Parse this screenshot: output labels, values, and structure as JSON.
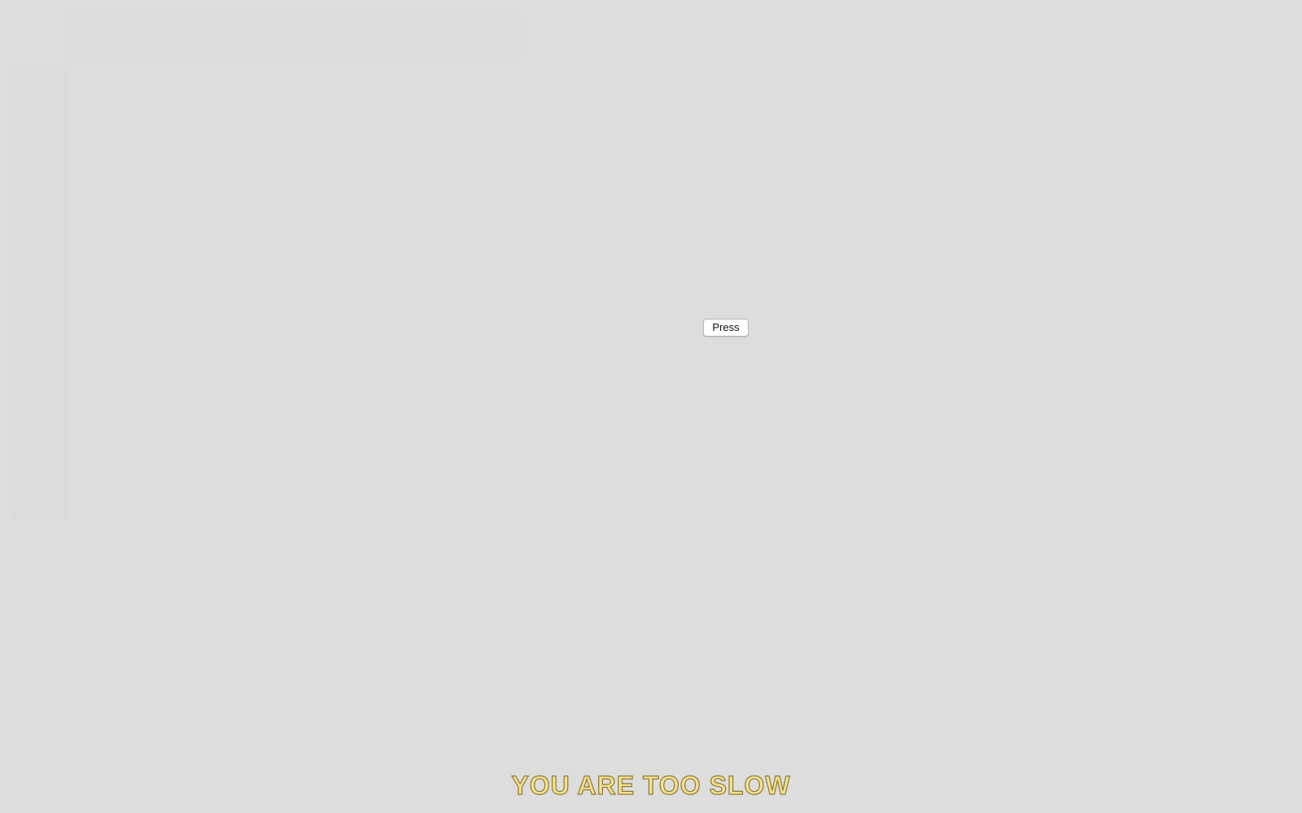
{
  "main": {
    "button_label": "Press",
    "message": "YOU ARE TOO SLOW"
  },
  "colors": {
    "background": "#dddddd",
    "message_fill": "#f7e08a",
    "message_outline": "#8a7a3a"
  }
}
